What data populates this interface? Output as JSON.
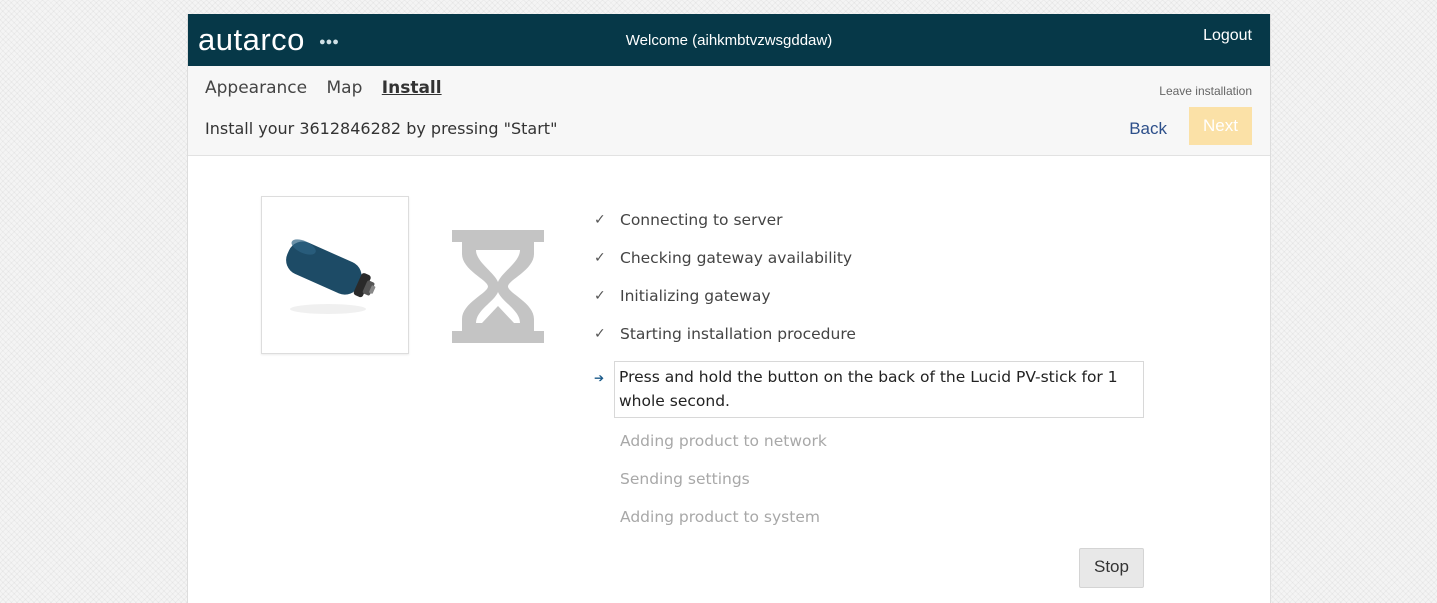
{
  "header": {
    "logo": "autarco",
    "logo_mark": "⁂",
    "welcome": "Welcome (aihkmbtvzwsgddaw)",
    "logout": "Logout"
  },
  "nav": {
    "tabs": [
      {
        "label": "Appearance",
        "active": false
      },
      {
        "label": "Map",
        "active": false
      },
      {
        "label": "Install",
        "active": true
      }
    ],
    "leave": "Leave installation",
    "back": "Back",
    "next": "Next"
  },
  "instruction": "Install your 3612846282 by pressing \"Start\"",
  "steps": [
    {
      "label": "Connecting to server",
      "status": "done",
      "mark": "✓"
    },
    {
      "label": "Checking gateway availability",
      "status": "done",
      "mark": "✓"
    },
    {
      "label": "Initializing gateway",
      "status": "done",
      "mark": "✓"
    },
    {
      "label": "Starting installation procedure",
      "status": "done",
      "mark": "✓"
    },
    {
      "label": "Press and hold the button on the back of the Lucid PV-stick for 1 whole second.",
      "status": "current",
      "mark": "➔"
    },
    {
      "label": "Adding product to network",
      "status": "pending",
      "mark": ""
    },
    {
      "label": "Sending settings",
      "status": "pending",
      "mark": ""
    },
    {
      "label": "Adding product to system",
      "status": "pending",
      "mark": ""
    }
  ],
  "stop": "Stop",
  "colors": {
    "header_bg": "#063848",
    "next_disabled": "#fbe1a7",
    "device": "#1d4b66",
    "hourglass": "#c4c4c4"
  },
  "icons": [
    "hourglass-icon",
    "usb-stick-image"
  ]
}
